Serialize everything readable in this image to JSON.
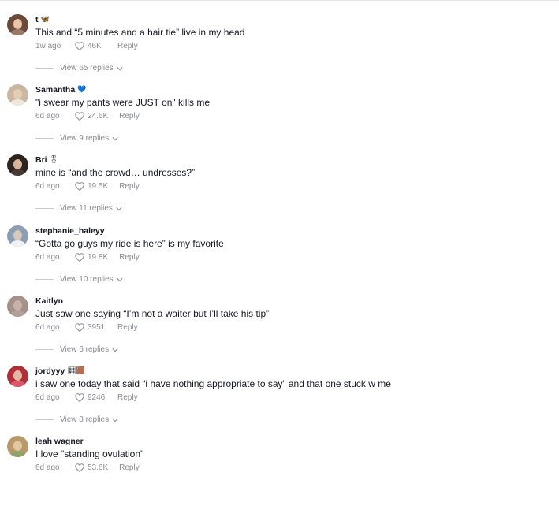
{
  "comments": [
    {
      "username": "t",
      "badge": "🦋",
      "badge_alt": "GIF🔍",
      "text": "This and “5 minutes and a hair tie” live in my head",
      "time": "1w ago",
      "likes": "46K",
      "reply_label": "Reply",
      "view_replies": "View 65 replies",
      "avatar_colors": [
        "#6b4a3a",
        "#e8c4a8",
        "#9a7a66"
      ]
    },
    {
      "username": "Samantha",
      "badge": "💙",
      "text": "\"i swear my pants were JUST on\" kills me",
      "time": "6d ago",
      "likes": "24.6K",
      "reply_label": "Reply",
      "view_replies": "View 9 replies",
      "avatar_colors": [
        "#c9b7a2",
        "#e5cdb3",
        "#f0e7dc"
      ]
    },
    {
      "username": "Bri",
      "badge": "🎖",
      "text": "mine is “and the crowd… undresses?”",
      "time": "6d ago",
      "likes": "19.5K",
      "reply_label": "Reply",
      "view_replies": "View 11 replies",
      "avatar_colors": [
        "#2d2420",
        "#d9b49a",
        "#4a3a34"
      ]
    },
    {
      "username": "stephanie_haleyy",
      "badge": "",
      "text": "“Gotta go guys my ride is here” is my favorite",
      "time": "6d ago",
      "likes": "19.8K",
      "reply_label": "Reply",
      "view_replies": "View 10 replies",
      "avatar_colors": [
        "#8d9eb3",
        "#d8c8bb",
        "#eef2f6"
      ]
    },
    {
      "username": "Kaitlyn",
      "badge": "",
      "text": "Just saw one saying “I’m not a waiter but I’ll take his tip”",
      "time": "6d ago",
      "likes": "3951",
      "reply_label": "Reply",
      "view_replies": "View 6 replies",
      "avatar_colors": [
        "#a3918a",
        "#c8b2a8",
        "#b49f96"
      ]
    },
    {
      "username": "jordyyy",
      "badge": "🎛🟫",
      "text": "i saw one today that said “i have nothing appropriate to say” and that one stuck w me",
      "time": "6d ago",
      "likes": "9246",
      "reply_label": "Reply",
      "view_replies": "View 8 replies",
      "avatar_colors": [
        "#b0303a",
        "#e2b7a4",
        "#d85a6a"
      ]
    },
    {
      "username": "leah wagner",
      "badge": "",
      "text": "I love \"standing ovulation\"",
      "time": "6d ago",
      "likes": "53.6K",
      "reply_label": "Reply",
      "view_replies": "",
      "avatar_colors": [
        "#b89a6a",
        "#e3c7a3",
        "#8fa36a"
      ]
    }
  ]
}
